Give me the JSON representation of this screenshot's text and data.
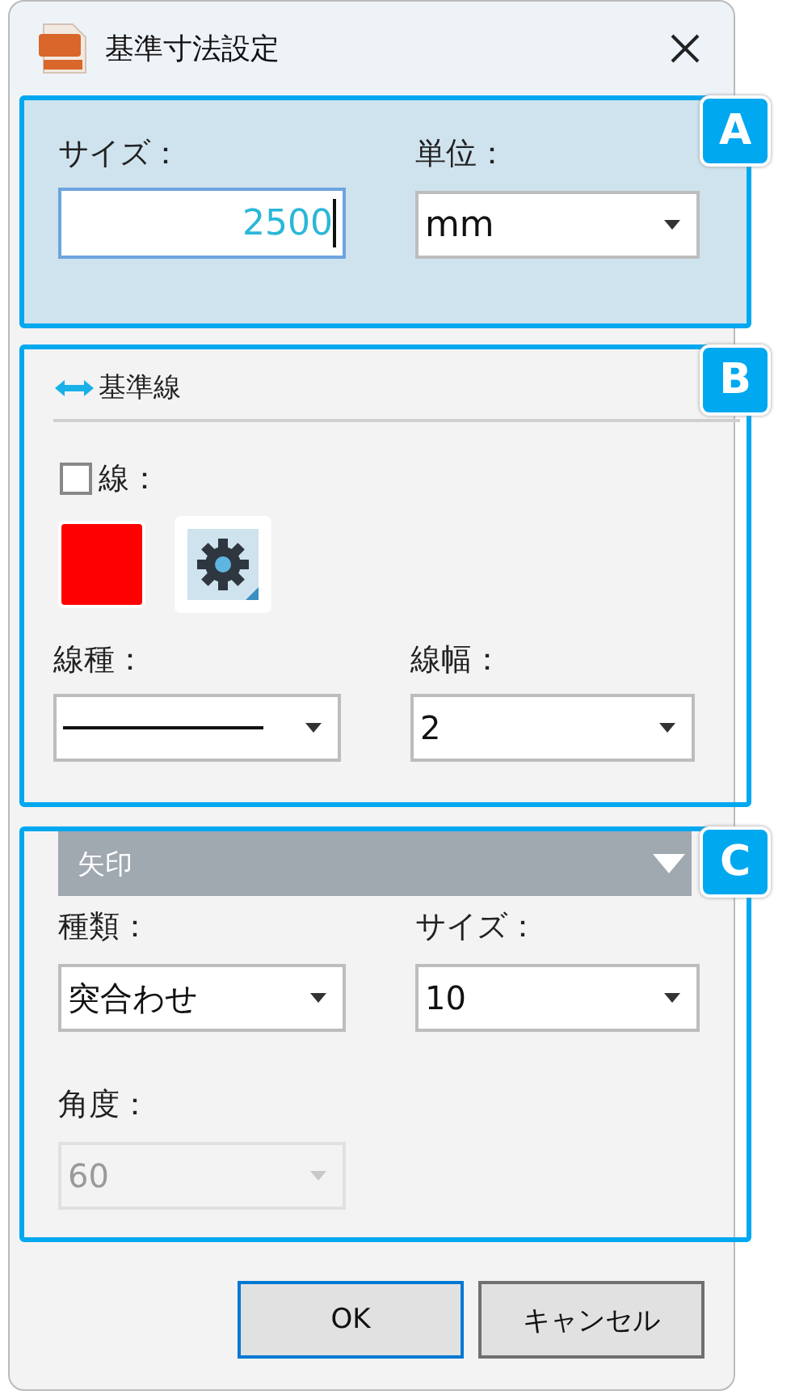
{
  "window": {
    "title": "基準寸法設定"
  },
  "size_section": {
    "badge": "A",
    "size": {
      "label": "サイズ：",
      "value": "2500"
    },
    "unit": {
      "label": "単位：",
      "value": "mm"
    }
  },
  "baseline_section": {
    "badge": "B",
    "header": "基準線",
    "line": {
      "label": "線：",
      "checked": false,
      "color": "#ff0000"
    },
    "line_type": {
      "label": "線種：",
      "kind": "solid"
    },
    "line_width": {
      "label": "線幅：",
      "value": "2"
    }
  },
  "arrow_section": {
    "badge": "C",
    "header": "矢印",
    "expanded": true,
    "kind": {
      "label": "種類：",
      "value": "突合わせ"
    },
    "size": {
      "label": "サイズ：",
      "value": "10"
    },
    "angle": {
      "label": "角度：",
      "value": "60",
      "disabled": true
    }
  },
  "buttons": [
    {
      "label": "OK",
      "default": true
    },
    {
      "label": "キャンセル",
      "default": false
    }
  ]
}
